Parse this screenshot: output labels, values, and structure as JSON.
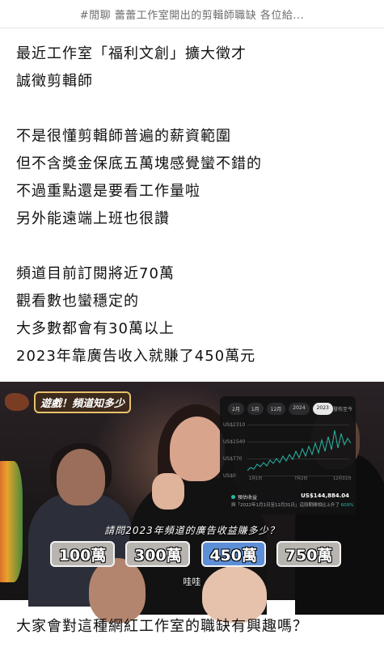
{
  "header": {
    "title": "#閒聊 蕾蕾工作室開出的剪輯師職缺 各位給..."
  },
  "post": {
    "paragraphs": [
      [
        "最近工作室「福利文創」擴大徵才",
        "誠徵剪輯師"
      ],
      [
        "不是很懂剪輯師普遍的薪資範圍",
        "但不含獎金保底五萬塊感覺蠻不錯的",
        "不過重點還是要看工作量啦",
        "另外能遠端上班也很讚"
      ],
      [
        "頻道目前訂閱將近70萬",
        "觀看數也蠻穩定的",
        "大多數都會有30萬以上",
        "2023年靠廣告收入就賺了450萬元"
      ]
    ],
    "closing": "大家會對這種網紅工作室的職缺有興趣嗎？"
  },
  "media": {
    "show_logo": "遊戲！頻道知多少",
    "phone": {
      "chips": [
        "2月",
        "1月",
        "12月",
        "2024",
        "2023"
      ],
      "active_chip": "2023",
      "menu": "發布至今",
      "y_labels": [
        "US$2310",
        "US$1540",
        "US$770",
        "US$0"
      ],
      "x_labels": [
        "1月1日",
        "7月2日",
        "12月31日"
      ],
      "revenue_label": "預估收益",
      "revenue_value": "US$144,884.04",
      "period_prefix": "與「2022年1月1日至12月31日」這段期間相比上升了 ",
      "period_change": "609%",
      "series_color": "#28b8a6"
    },
    "question": "請問2023年頻道的廣告收益賺多少？",
    "options": [
      "100萬",
      "300萬",
      "450萬",
      "750萬"
    ],
    "selected_option": "450萬",
    "caption": "哇哇"
  }
}
